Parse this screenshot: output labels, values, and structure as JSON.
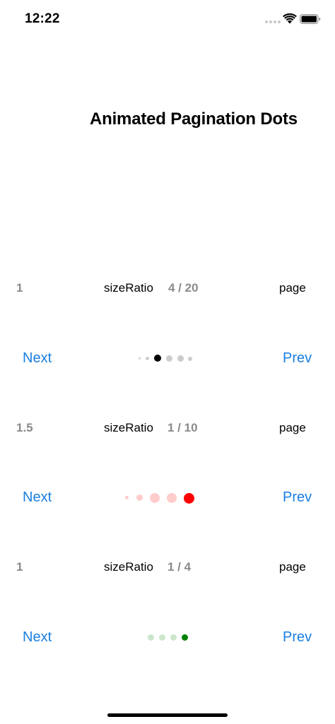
{
  "status_bar": {
    "time": "12:22"
  },
  "title": "Animated Pagination Dots",
  "rows": [
    {
      "ratio": "1",
      "size_ratio_label": "sizeRatio",
      "page_count": "4 / 20",
      "page_label": "page",
      "next_label": "Next",
      "prev_label": "Prev",
      "active_color": "#000000",
      "inactive_color": "#cccccc",
      "dot_count_visible": 6,
      "active_index": 2
    },
    {
      "ratio": "1.5",
      "size_ratio_label": "sizeRatio",
      "page_count": "1 / 10",
      "page_label": "page",
      "next_label": "Next",
      "prev_label": "Prev",
      "active_color": "#ff0000",
      "inactive_color": "#ffcccc",
      "dot_count_visible": 5,
      "active_index": 4
    },
    {
      "ratio": "1",
      "size_ratio_label": "sizeRatio",
      "page_count": "1 / 4",
      "page_label": "page",
      "next_label": "Next",
      "prev_label": "Prev",
      "active_color": "#008000",
      "inactive_color": "#cce6cc",
      "dot_count_visible": 4,
      "active_index": 3
    }
  ],
  "colors": {
    "button": "#1a7fe0",
    "muted_text": "#8a8a8a"
  }
}
